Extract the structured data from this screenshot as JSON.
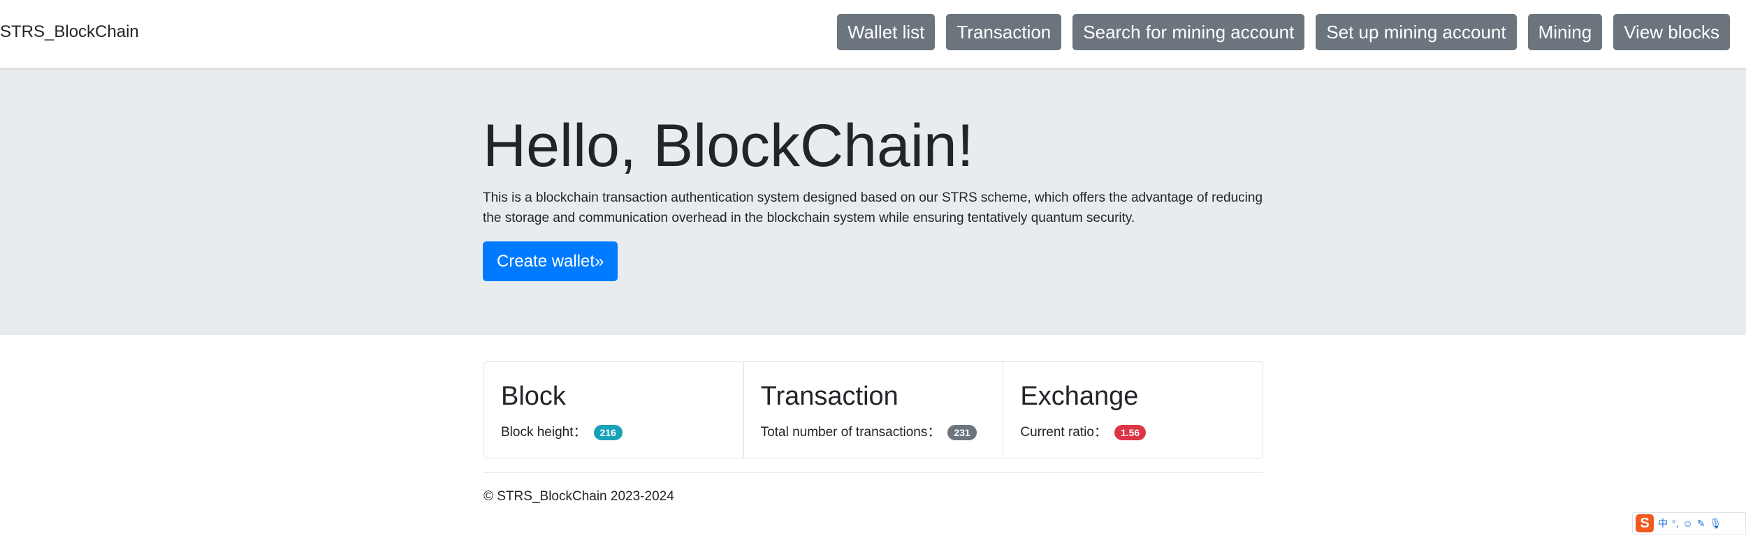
{
  "navbar": {
    "brand": "STRS_BlockChain",
    "buttons": [
      {
        "label": "Wallet list"
      },
      {
        "label": "Transaction"
      },
      {
        "label": "Search for mining account"
      },
      {
        "label": "Set up mining account"
      },
      {
        "label": "Mining"
      },
      {
        "label": "View blocks"
      }
    ]
  },
  "hero": {
    "title": "Hello, BlockChain!",
    "description": "This is a blockchain transaction authentication system designed based on our STRS scheme, which offers the advantage of reducing the storage and communication overhead in the blockchain system while ensuring tentatively quantum security.",
    "button_label": "Create wallet»"
  },
  "stats": [
    {
      "title": "Block",
      "label": "Block height：",
      "value": "216",
      "badge_color": "#17a2b8"
    },
    {
      "title": "Transaction",
      "label": "Total number of transactions：",
      "value": "231",
      "badge_color": "#6c757d"
    },
    {
      "title": "Exchange",
      "label": "Current ratio：",
      "value": "1.56",
      "badge_color": "#dc3545"
    }
  ],
  "footer": {
    "text": "© STRS_BlockChain 2023-2024"
  },
  "ime_toolbar": {
    "logo": "S",
    "icons": [
      "中",
      "°,",
      "☺",
      "✎",
      "🎙"
    ]
  },
  "colors": {
    "nav_button": "#6c757d",
    "primary_button": "#007bff",
    "jumbotron_bg": "#e9ecef"
  }
}
